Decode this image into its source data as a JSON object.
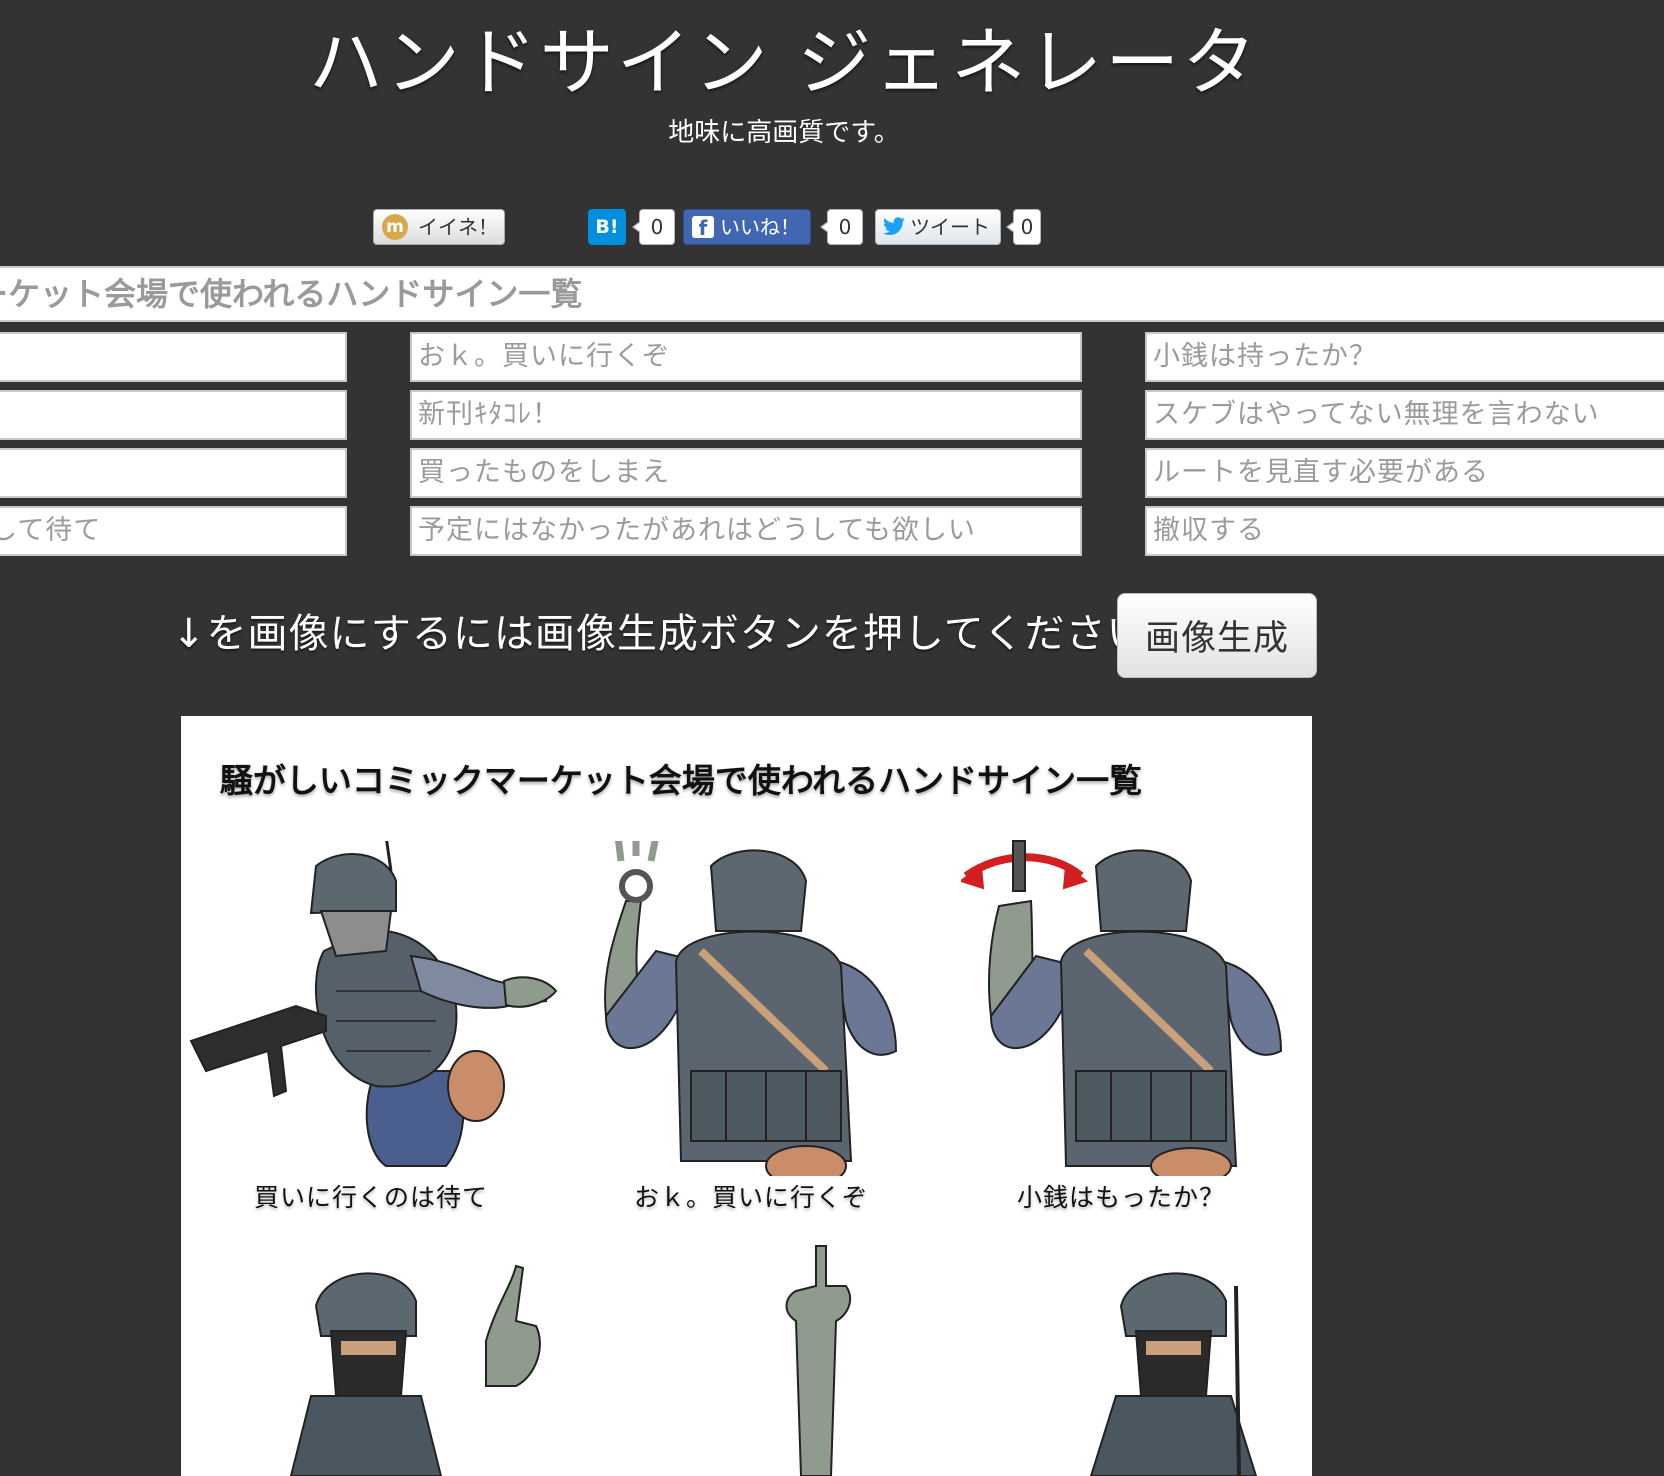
{
  "header": {
    "title": "ハンドサイン ジェネレータ",
    "subtitle": "地味に高画質です。"
  },
  "social": {
    "mixi_label": "イイネ！",
    "mixi_icon": "m",
    "hatena_label": "B!",
    "hatena_count": "0",
    "facebook_label": "いいね！",
    "facebook_icon": "f",
    "facebook_count": "0",
    "twitter_label": "ツイート",
    "twitter_count": "0"
  },
  "form": {
    "heading_value": "ーケット会場で使われるハンドサイン一覧",
    "col1": [
      "",
      "",
      "",
      "して待て"
    ],
    "col2": [
      "おｋ。買いに行くぞ",
      "新刊ｷﾀｺﾚ！",
      "買ったものをしまえ",
      "予定にはなかったがあれはどうしても欲しい"
    ],
    "col3": [
      "小銭は持ったか？",
      "スケブはやってない無理を言わない",
      "ルートを見直す必要がある",
      "撤収する"
    ]
  },
  "instruction": "↓を画像にするには画像生成ボタンを押してください",
  "generate_button": "画像生成",
  "preview": {
    "title": "騒がしいコミックマーケット会場で使われるハンドサイン一覧",
    "captions": [
      "買いに行くのは待て",
      "おｋ。買いに行くぞ",
      "小銭はもったか？"
    ]
  },
  "colors": {
    "background": "#333333",
    "facebook": "#4267b2",
    "hatena": "#008fde",
    "twitter": "#1da1f2",
    "mixi": "#d9a84a",
    "arrow_red": "#d22020"
  }
}
